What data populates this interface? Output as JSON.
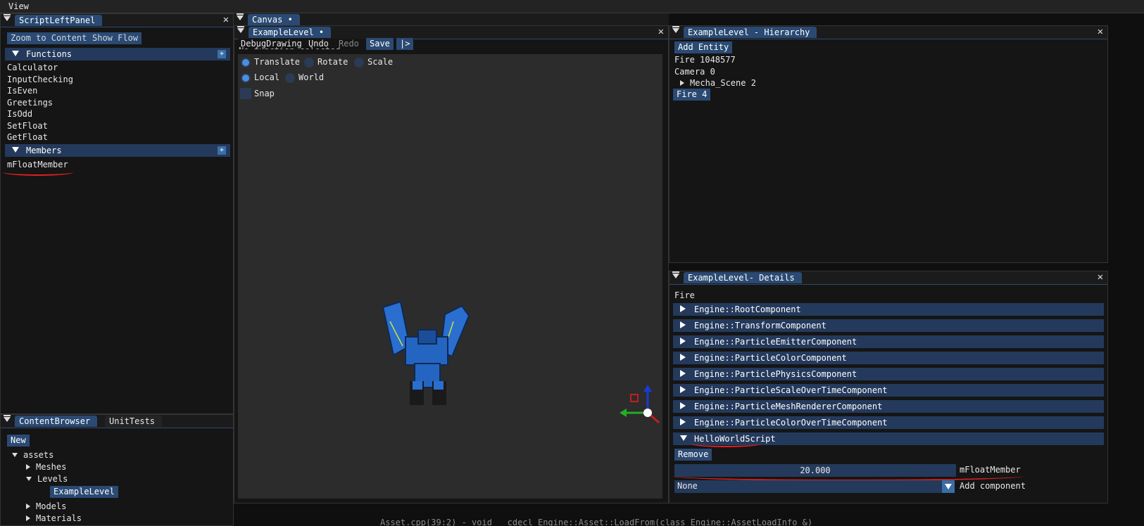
{
  "menu": {
    "view": "View"
  },
  "script_panel": {
    "tab": "ScriptLeftPanel",
    "zoom_btn": "Zoom to Content",
    "flow_btn": "Show Flow",
    "functions_header": "Functions",
    "functions": [
      "Calculator",
      "InputChecking",
      "IsEven",
      "Greetings",
      "IsOdd",
      "SetFloat",
      "GetFloat"
    ],
    "members_header": "Members",
    "members": [
      "mFloatMember"
    ]
  },
  "canvas": {
    "outer_tab": "Canvas •",
    "tab": "ExampleLevel •",
    "toolbar": {
      "debug": "DebugDrawing",
      "undo": "Undo",
      "redo": "Redo",
      "save": "Save",
      "play": "|>"
    },
    "no_function": "No function selected",
    "translate": "Translate",
    "rotate": "Rotate",
    "scale": "Scale",
    "local": "Local",
    "world": "World",
    "snap": "Snap"
  },
  "hierarchy": {
    "tab": "ExampleLevel - Hierarchy",
    "add_entity": "Add Entity",
    "items": [
      "Fire 1048577",
      "Camera 0",
      "Mecha_Scene 2",
      "Fire 4"
    ]
  },
  "details": {
    "tab": "ExampleLevel- Details",
    "entity_name": "Fire",
    "components": [
      "Engine::RootComponent",
      "Engine::TransformComponent",
      "Engine::ParticleEmitterComponent",
      "Engine::ParticleColorComponent",
      "Engine::ParticlePhysicsComponent",
      "Engine::ParticleScaleOverTimeComponent",
      "Engine::ParticleMeshRendererComponent",
      "Engine::ParticleColorOverTimeComponent"
    ],
    "script_component": "HelloWorldScript",
    "remove_btn": "Remove",
    "float_value": "20.000",
    "float_label": "mFloatMember",
    "select_value": "None",
    "add_component": "Add component"
  },
  "content_browser": {
    "tab": "ContentBrowser",
    "tab2": "UnitTests",
    "new_btn": "New",
    "tree": {
      "assets": "assets",
      "meshes": "Meshes",
      "levels": "Levels",
      "example_level": "ExampleLevel",
      "models": "Models",
      "materials": "Materials"
    }
  },
  "status": {
    "log": "Asset.cpp(39:2) - void __cdecl Engine::Asset::LoadFrom(class Engine::AssetLoadInfo &)"
  },
  "colors": {
    "accent": "#2a4a73",
    "header": "#243a5c",
    "annotation": "#e02020"
  }
}
